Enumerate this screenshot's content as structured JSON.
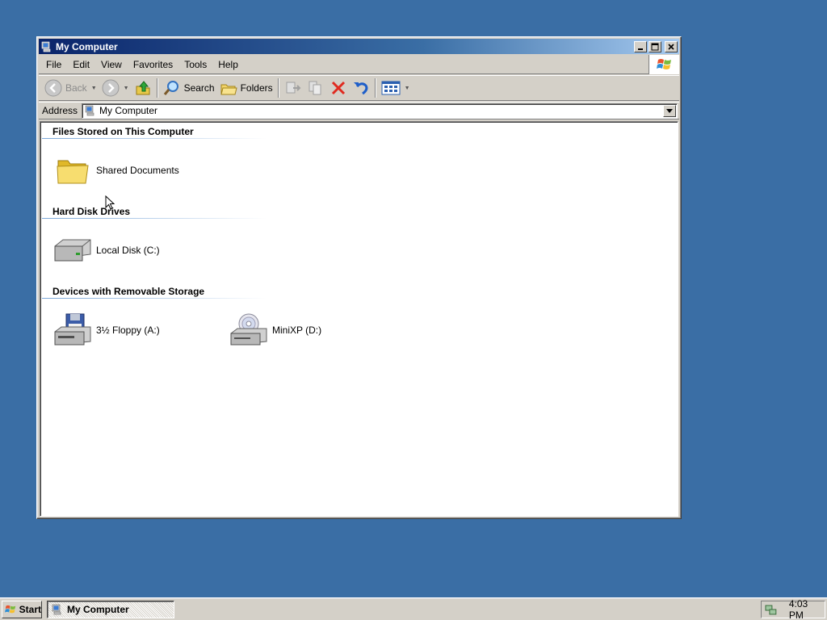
{
  "window": {
    "title": "My Computer"
  },
  "menu": [
    "File",
    "Edit",
    "View",
    "Favorites",
    "Tools",
    "Help"
  ],
  "toolbar": {
    "back_label": "Back",
    "search_label": "Search",
    "folders_label": "Folders"
  },
  "address": {
    "label": "Address",
    "value": "My Computer"
  },
  "groups": {
    "files": {
      "header": "Files Stored on This Computer",
      "items": [
        "Shared Documents"
      ]
    },
    "hdd": {
      "header": "Hard Disk Drives",
      "items": [
        "Local Disk (C:)"
      ]
    },
    "removable": {
      "header": "Devices with Removable Storage",
      "items": [
        "3½ Floppy (A:)",
        "MiniXP (D:)"
      ]
    }
  },
  "taskbar": {
    "start_label": "Start",
    "task_label": "My Computer",
    "clock": "4:03 PM"
  },
  "colors": {
    "desktop": "#3a6ea5",
    "title_active": "#0a246a",
    "face": "#d4d0c8"
  }
}
